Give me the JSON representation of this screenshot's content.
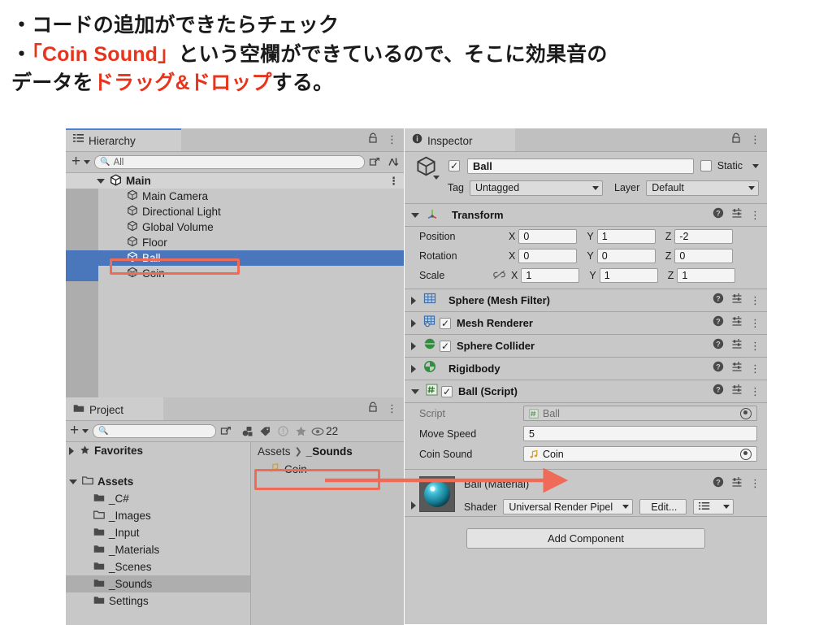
{
  "caption": {
    "line1": "・コードの追加ができたらチェック",
    "line2_bullet": "・",
    "line2_red": "「Coin Sound」",
    "line2_rest": "という空欄ができているので、そこに効果音の",
    "line3_a": "データを",
    "line3_red": "ドラッグ&ドロップ",
    "line3_b": "する。",
    "accent_color": "#e8341c"
  },
  "hierarchy": {
    "tab_label": "Hierarchy",
    "tab_icon": "hierarchy-icon",
    "lock_icon": "lock-icon",
    "menu_icon": "kebab-menu-icon",
    "add_label": "+",
    "search_placeholder": "All",
    "search_icon": "search-icon",
    "expand_icon": "expand-window-icon",
    "sort_icon": "sort-icon",
    "items": [
      {
        "label": "Main",
        "depth": 0,
        "root": true,
        "selected": false
      },
      {
        "label": "Main Camera",
        "depth": 1,
        "root": false,
        "selected": false
      },
      {
        "label": "Directional Light",
        "depth": 1,
        "root": false,
        "selected": false
      },
      {
        "label": "Global Volume",
        "depth": 1,
        "root": false,
        "selected": false
      },
      {
        "label": "Floor",
        "depth": 1,
        "root": false,
        "selected": false
      },
      {
        "label": "Ball",
        "depth": 1,
        "root": false,
        "selected": true
      },
      {
        "label": "Coin",
        "depth": 1,
        "root": false,
        "selected": false
      }
    ]
  },
  "project": {
    "tab_label": "Project",
    "tab_icon": "folder-icon",
    "lock_icon": "lock-icon",
    "menu_icon": "kebab-menu-icon",
    "add_label": "+",
    "search_placeholder": "",
    "search_icon": "search-icon",
    "filter_icons": [
      "asset-filter-icon",
      "label-filter-icon",
      "warning-filter-icon",
      "favorite-filter-icon",
      "visibility-icon"
    ],
    "visible_count": "22",
    "tree": [
      {
        "label": "Favorites",
        "depth": 0,
        "bold": true,
        "icon": "star-icon",
        "arrow": "right",
        "selected": false
      },
      {
        "label": "Assets",
        "depth": 0,
        "bold": true,
        "icon": "folder-open-icon",
        "arrow": "down",
        "selected": false
      },
      {
        "label": "_C#",
        "depth": 1,
        "bold": false,
        "icon": "folder-icon",
        "arrow": "",
        "selected": false
      },
      {
        "label": "_Images",
        "depth": 1,
        "bold": false,
        "icon": "folder-empty-icon",
        "arrow": "",
        "selected": false
      },
      {
        "label": "_Input",
        "depth": 1,
        "bold": false,
        "icon": "folder-icon",
        "arrow": "",
        "selected": false
      },
      {
        "label": "_Materials",
        "depth": 1,
        "bold": false,
        "icon": "folder-icon",
        "arrow": "",
        "selected": false
      },
      {
        "label": "_Scenes",
        "depth": 1,
        "bold": false,
        "icon": "folder-icon",
        "arrow": "",
        "selected": false
      },
      {
        "label": "_Sounds",
        "depth": 1,
        "bold": false,
        "icon": "folder-icon",
        "arrow": "",
        "selected": true
      },
      {
        "label": "Settings",
        "depth": 1,
        "bold": false,
        "icon": "folder-icon",
        "arrow": "",
        "selected": false
      }
    ],
    "breadcrumb_root": "Assets",
    "breadcrumb_sep": "❯",
    "breadcrumb_current": "_Sounds",
    "assets": [
      {
        "label": "Coin",
        "icon": "audio-clip-icon"
      }
    ]
  },
  "inspector": {
    "tab_label": "Inspector",
    "tab_icon": "info-icon",
    "lock_icon": "lock-icon",
    "menu_icon": "kebab-menu-icon",
    "object_icon": "gameobject-cube-icon",
    "enabled": true,
    "enabled_mark": "✓",
    "name": "Ball",
    "static_label": "Static",
    "static_checked": false,
    "tag_label": "Tag",
    "tag_value": "Untagged",
    "layer_label": "Layer",
    "layer_value": "Default",
    "help_icon": "help-icon",
    "preset_icon": "preset-icon",
    "menu_icon_row": "kebab-menu-icon",
    "transform": {
      "title": "Transform",
      "icon": "transform-axis-icon",
      "rows": [
        {
          "label": "Position",
          "x": "0",
          "y": "1",
          "z": "-2",
          "link": false
        },
        {
          "label": "Rotation",
          "x": "0",
          "y": "0",
          "z": "0",
          "link": false
        },
        {
          "label": "Scale",
          "x": "1",
          "y": "1",
          "z": "1",
          "link": true
        }
      ],
      "axis_x": "X",
      "axis_y": "Y",
      "axis_z": "Z",
      "link_icon": "unlinked-scale-icon"
    },
    "components": [
      {
        "title": "Sphere (Mesh Filter)",
        "icon": "mesh-filter-icon",
        "has_checkbox": false,
        "checked": false,
        "expanded": false
      },
      {
        "title": "Mesh Renderer",
        "icon": "mesh-renderer-icon",
        "has_checkbox": true,
        "checked": true,
        "expanded": false
      },
      {
        "title": "Sphere Collider",
        "icon": "sphere-collider-icon",
        "has_checkbox": true,
        "checked": true,
        "expanded": false
      },
      {
        "title": "Rigidbody",
        "icon": "rigidbody-icon",
        "has_checkbox": false,
        "checked": false,
        "expanded": false
      }
    ],
    "script_component": {
      "title": "Ball (Script)",
      "icon": "csharp-script-icon",
      "has_checkbox": true,
      "checked": true,
      "expanded": true,
      "fields": [
        {
          "label": "Script",
          "value": "Ball",
          "type": "object",
          "dim": true,
          "icon": "csharp-script-icon"
        },
        {
          "label": "Move Speed",
          "value": "5",
          "type": "text",
          "dim": false,
          "icon": ""
        },
        {
          "label": "Coin Sound",
          "value": "Coin",
          "type": "object",
          "dim": false,
          "icon": "audio-clip-icon"
        }
      ]
    },
    "material": {
      "title": "Ball (Material)",
      "preview_icon": "material-sphere-preview",
      "shader_label": "Shader",
      "shader_value": "Universal Render Pipel",
      "edit_label": "Edit...",
      "list_icon": "shader-list-icon"
    },
    "add_component_label": "Add Component"
  },
  "annotations": {
    "highlight_color": "#ef6a57",
    "arrow_color": "#ef6a57",
    "boxes": [
      "hierarchy-ball-row",
      "project-coin-asset"
    ],
    "arrow": "coin-asset-to-coin-sound-field"
  }
}
